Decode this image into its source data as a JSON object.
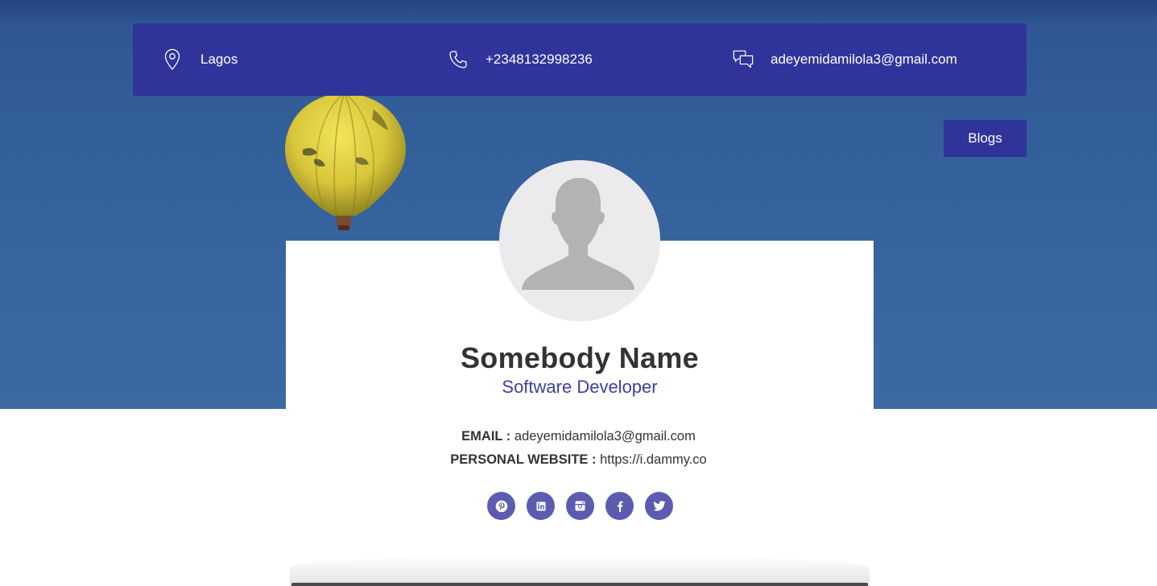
{
  "contact_bar": {
    "location": "Lagos",
    "phone": "+2348132998236",
    "email": "adeyemidamilola3@gmail.com"
  },
  "nav": {
    "blogs_label": "Blogs"
  },
  "profile": {
    "name": "Somebody Name",
    "role": "Software Developer",
    "email_label": "EMAIL :",
    "email_value": "adeyemidamilola3@gmail.com",
    "website_label": "PERSONAL WEBSITE :",
    "website_value": "https://i.dammy.co"
  },
  "socials": [
    "pinterest-icon",
    "linkedin-icon",
    "instagram-icon",
    "facebook-icon",
    "twitter-icon"
  ],
  "colors": {
    "accent": "#30349a",
    "role_text": "#3d3fa3",
    "social_bg": "#5b5cb0",
    "hero_bg": "#3a66a0"
  }
}
